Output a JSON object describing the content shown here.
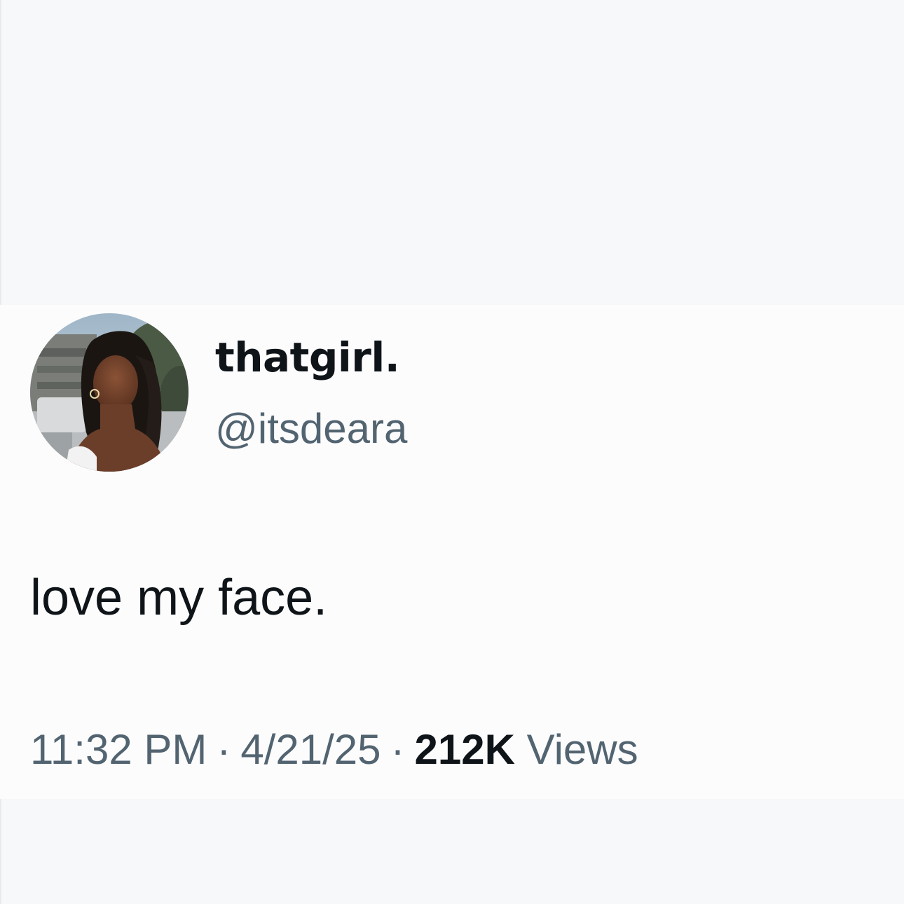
{
  "tweet": {
    "display_name": "thatgirl.",
    "handle": "@itsdeara",
    "text": "love my face.",
    "time": "11:32 PM",
    "separator": "·",
    "date": "4/21/25",
    "views_count": "212K",
    "views_label": "Views"
  },
  "colors": {
    "background": "#f7f8f9",
    "primary_text": "#0f1419",
    "secondary_text": "#536471"
  }
}
